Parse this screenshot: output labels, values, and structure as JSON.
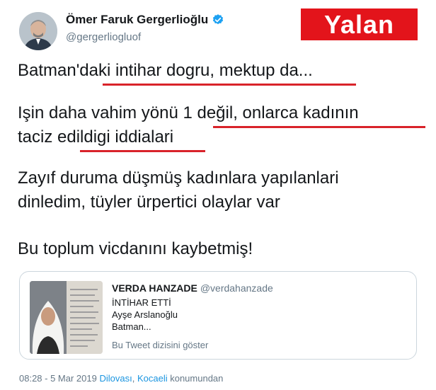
{
  "author": {
    "name": "Ömer Faruk Gergerlioğlu",
    "handle": "@gergerliogluof",
    "verified": true
  },
  "stamp": {
    "label": "Yalan",
    "color": "#e3141b"
  },
  "tweet": {
    "lines": [
      "Batman'daki intihar dogru, mektup da...",
      "Işin daha vahim yönü 1 değil, onlarca kadının",
      "taciz edildigi iddialari",
      "Zayıf duruma düşmüş kadınlara yapılanlari",
      "dinledim, tüyler ürpertici olaylar var",
      "Bu toplum vicdanını kaybetmiş!"
    ],
    "underline_color": "#d9232a"
  },
  "quoted": {
    "name": "VERDA HANZADE",
    "handle": "@verdahanzade",
    "lines": [
      "İNTİHAR ETTİ",
      "Ayşe Arslanoğlu",
      "Batman..."
    ],
    "show_thread": "Bu Tweet dizisini göster"
  },
  "meta": {
    "time": "08:28 - 5 Mar 2019",
    "location_1": "Dilovası",
    "separator": ", ",
    "location_2": "Kocaeli",
    "suffix": " konumundan",
    "link_color": "#1b95e0"
  },
  "icons": {
    "verified": "verified-badge-icon"
  }
}
